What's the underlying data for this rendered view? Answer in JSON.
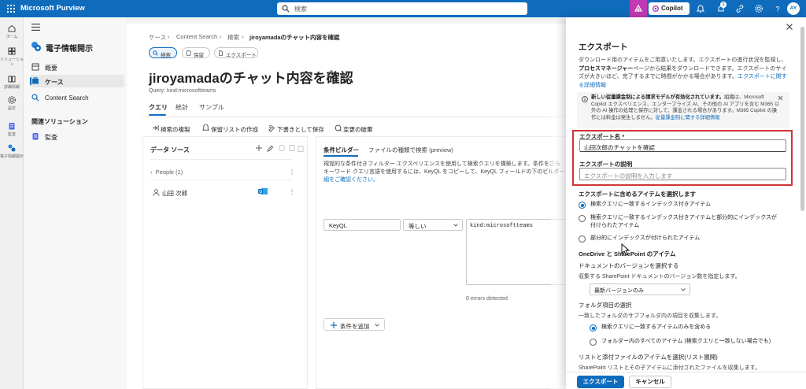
{
  "topbar": {
    "brand": "Microsoft Purview",
    "search_placeholder": "検索",
    "copilot_label": "Copilot",
    "notification_count": "1",
    "avatar_initials": "AY",
    "color": "#0f6cbd",
    "copilot_accent": "#c239b3"
  },
  "rail": {
    "items": [
      {
        "label": "ホーム",
        "icon": "home-icon"
      },
      {
        "label": "ソリューション",
        "icon": "solutions-icon"
      },
      {
        "label": "詳細情報",
        "icon": "book-icon"
      },
      {
        "label": "設定",
        "icon": "gear-icon"
      },
      {
        "label": "監査",
        "icon": "audit-icon"
      },
      {
        "label": "電子情報開示",
        "icon": "ediscovery-icon"
      }
    ]
  },
  "nav": {
    "title": "電子情報開示",
    "items": [
      {
        "label": "概要",
        "icon": "overview-icon"
      },
      {
        "label": "ケース",
        "icon": "case-icon"
      },
      {
        "label": "Content Search",
        "icon": "search-icon"
      }
    ],
    "section": "関連ソリューション",
    "related": [
      {
        "label": "監査",
        "icon": "audit-icon"
      }
    ]
  },
  "main": {
    "breadcrumb": [
      "ケース",
      "Content Search",
      "検索",
      "jiroyamadaのチャット内容を確認"
    ],
    "pills": [
      {
        "label": "検索",
        "icon": "search-icon"
      },
      {
        "label": "保留",
        "icon": "hold-icon"
      },
      {
        "label": "エクスポート",
        "icon": "export-icon"
      }
    ],
    "title": "jiroyamadaのチャット内容を確認",
    "query": "Query: kind:microsoftteams",
    "tabs": [
      "クエリ",
      "統計",
      "サンプル"
    ],
    "commands": [
      {
        "label": "検索の複製",
        "icon": "duplicate-icon"
      },
      {
        "label": "保留リストの作成",
        "icon": "hold-icon"
      },
      {
        "label": "下書きとして保存",
        "icon": "save-icon"
      },
      {
        "label": "変更の破棄",
        "icon": "discard-icon"
      }
    ],
    "data_source": {
      "title": "データ ソース",
      "group": "People (1)",
      "person": "山田 次郎"
    },
    "condition_builder": {
      "tab_active": "条件ビルダー",
      "tab_other": "ファイルの種類で検索 (preview)",
      "desc_lines": [
        "視覚的な条件付きフィルター エクスペリエンスを使用して検索クエリを構築します。条件をさら",
        "キーワード クエリ言語を使用するには、KeyQL をコピーして、KeyQL フィールドの下のビルダー",
        "細をご確認ください。"
      ],
      "field": "KeyQL",
      "operator": "等しい",
      "value": "kind:microsoftteams",
      "errors": "0 errors detected",
      "add_condition": "条件を追加"
    }
  },
  "flyout": {
    "title": "エクスポート",
    "intro_1": "ダウンロード用のアイテムをご用意いたします。エクスポートの進行状況を監視し、",
    "intro_bold": "プロセスマネージャー",
    "intro_2": "ページから結果をダウンロードできます。エクスポートのサイズが大きいほど、完了するまでに時間がかかる場合があります。",
    "intro_link": "エクスポートに関する詳細情報",
    "banner_bold": "新しい従量課金制による請求モデルが有効化されています。",
    "banner_text": "組織は、Microsoft Copilot エクスペリエンス、エンタープライズ AI、その他の AI アプリを含む M365 以外の AI 操作の処理と保存に対して、課金される場合があります。M365 Copilot の操作には料金は発生しません。",
    "banner_link": "従量課金制に関する詳細情報",
    "name_label": "エクスポート名 *",
    "name_value": "山田次郎のチャットを確認",
    "desc_label": "エクスポートの説明",
    "desc_placeholder": "エクスポートの説明を入力します",
    "items_heading": "エクスポートに含めるアイテムを選択します",
    "options": [
      {
        "label": "検索クエリに一致するインデックス付きアイテム",
        "selected": true
      },
      {
        "label": "検索クエリに一致するインデックス付きアイテムと部分的にインデックスが付けられたアイテム",
        "selected": false
      },
      {
        "label": "部分的にインデックスが付けられたアイテム",
        "selected": false
      }
    ],
    "options_line2": "付けられたアイテム",
    "options_line1_b": "検索クエリに一致するインデックス付きアイテムと部分的にインデックスが",
    "od_heading": "OneDrive と SharePoint のアイテム",
    "doc_ver_label": "ドキュメントのバージョンを選択する",
    "doc_ver_desc": "収集する SharePoint ドキュメントのバージョン数を指定します。",
    "doc_ver_value": "最新バージョンのみ",
    "folder_label": "フォルダ項目の選択",
    "folder_desc": "一致したフォルダのサブフォルダ内の項目を収集します。",
    "folder_options": [
      {
        "label": "検索クエリに一致するアイテムのみを含める",
        "selected": true
      },
      {
        "label": "フォルダー内のすべてのアイテム (検索クエリと一致しない場合でも)",
        "selected": false
      }
    ],
    "list_label": "リストと添付ファイルのアイテムを選択(リスト展開)",
    "list_desc": "SharePoint リストとその子アイテムに添付されたファイルを収集します。",
    "export_button": "エクスポート",
    "cancel_button": "キャンセル",
    "highlight_color": "#d13438"
  }
}
